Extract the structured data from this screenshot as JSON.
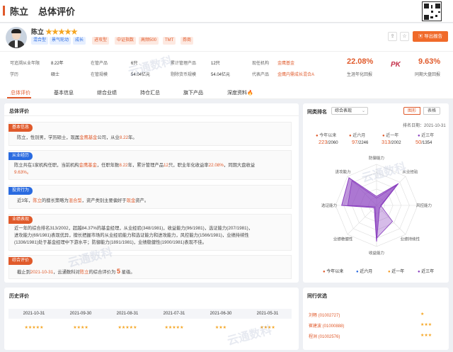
{
  "header": {
    "name": "陈立",
    "title": "总体评价"
  },
  "profile": {
    "name": "陈立",
    "stars": "★★★★★",
    "tags": [
      {
        "label": "混合型",
        "color": "#2a6be0",
        "bg": "#e6efff"
      },
      {
        "label": "景气轮动",
        "color": "#2a6be0",
        "bg": "#e6efff"
      },
      {
        "label": "成长",
        "color": "#2a6be0",
        "bg": "#e6efff"
      },
      {
        "label": "进攻型",
        "color": "#e05a2b",
        "bg": "#fde9e1"
      },
      {
        "label": "中证指数",
        "color": "#e05a2b",
        "bg": "#fde9e1"
      },
      {
        "label": "高频500",
        "color": "#e05a2b",
        "bg": "#fde9e1"
      },
      {
        "label": "TMT",
        "color": "#e05a2b",
        "bg": "#fde9e1"
      },
      {
        "label": "券商",
        "color": "#e05a2b",
        "bg": "#fde9e1"
      }
    ],
    "export_label": "导出报告",
    "share_icon": "share-icon",
    "favorite_icon": "star-icon"
  },
  "stats": {
    "rows": [
      [
        {
          "label": "可追溯从业年限",
          "value": "8.22年"
        },
        {
          "label": "在管产品",
          "value": "6只"
        },
        {
          "label": "累计管理产品",
          "value": "12只"
        },
        {
          "label": "现任机构",
          "value": "金鹰基金"
        }
      ],
      [
        {
          "label": "学历",
          "value": "硕士"
        },
        {
          "label": "在管规模",
          "value": "54.04亿元"
        },
        {
          "label": "剔除货币规模",
          "value": "54.04亿元"
        },
        {
          "label": "代表产品",
          "value": "金鹰内需成长混合A"
        }
      ]
    ],
    "annual_return": "22.08%",
    "annual_return_label": "生涯年化回报",
    "pk_label": "PK",
    "max_drawdown": "9.63%",
    "max_drawdown_label": "同期大盘回报"
  },
  "tabs": [
    "总体评价",
    "基本信息",
    "综合业绩",
    "持仓汇总",
    "旗下产品",
    "深度资料"
  ],
  "overall": {
    "title": "总体评价",
    "sections": [
      {
        "badge": "基本信息",
        "color": "#e05a2b",
        "text_parts": [
          "陈立，性别男，学历硕士，现属金鹰基金公司，从业8.22年。"
        ]
      },
      {
        "badge": "从业经历",
        "color": "#2a6be0",
        "text_parts": [
          "陈立共在1家机构任职，当前机构金鹰基金，任职年数8.22年，累计管理产品12只，职业年化收益率22.08%，同期大盘收益",
          "9.63%。"
        ]
      },
      {
        "badge": "投资行为",
        "color": "#2a6be0",
        "text_parts": [
          "近3年，陈立的擅长策略为混合型，资产类别主要偏好于现金资产。"
        ]
      },
      {
        "badge": "业绩表现",
        "color": "#e05a2b",
        "text_parts": [
          "近一年的综合排名313/2002，超越84.37%的基金经理，从业经验(348/1981)，收益能力(96/1981)，选证能力(207/1981)，",
          "进攻能力(69/1981)表现优异，擅长把握市场的从业经验能力和选证能力和进攻能力，风控能力(1566/1981)，业绩持续性",
          "(1336/1981)处于基金经理中下游水平；防御能力(1891/1981)，业绩稳健性(1900/1981)表现不佳。"
        ]
      },
      {
        "badge": "综合评价",
        "color": "#e05a2b",
        "text_parts": [
          "截止到2021-10-31，云通数科对陈立的综合评价为",
          "5",
          "星级。"
        ]
      }
    ]
  },
  "ranking": {
    "title": "同类排名",
    "select": "综合表现",
    "toggle": [
      "图形",
      "表格"
    ],
    "date": "排名日期：2021-10-31",
    "periods": [
      {
        "label": "今年以来",
        "rank": "223",
        "total": "/2060",
        "color": "#e05a2b"
      },
      {
        "label": "近六月",
        "rank": "97",
        "total": "/2246",
        "color": "#e05a2b"
      },
      {
        "label": "近一年",
        "rank": "313",
        "total": "/2002",
        "color": "#e05a2b"
      },
      {
        "label": "近三年",
        "rank": "50",
        "total": "/1354",
        "color": "#8a3fbf"
      }
    ],
    "axes": [
      "防御能力",
      "从业经验",
      "风控能力",
      "业绩持续性",
      "收益能力",
      "业绩稳健性",
      "选证能力",
      "进攻能力"
    ],
    "legend": [
      "今年以来",
      "近六月",
      "近一年",
      "近三年"
    ],
    "legend_colors": [
      "#e05a2b",
      "#2a6be0",
      "#f59a23",
      "#8a3fbf"
    ]
  },
  "history": {
    "title": "历史评价",
    "items": [
      {
        "date": "2021-10-31",
        "stars": "★★★★★"
      },
      {
        "date": "2021-09-30",
        "stars": "★★★★"
      },
      {
        "date": "2021-08-31",
        "stars": "★★★★★"
      },
      {
        "date": "2021-07-31",
        "stars": "★★★★★"
      },
      {
        "date": "2021-06-30",
        "stars": "★★★"
      },
      {
        "date": "2021-05-31",
        "stars": "★★★★"
      }
    ]
  },
  "peers": {
    "title": "同行优选",
    "items": [
      {
        "name": "刘畅 (01002727)",
        "stars": "★"
      },
      {
        "name": "崔建波 (01000888)",
        "stars": "★★★"
      },
      {
        "name": "程洲 (01002576)",
        "stars": "★★★"
      }
    ]
  },
  "watermark": "云通数科"
}
